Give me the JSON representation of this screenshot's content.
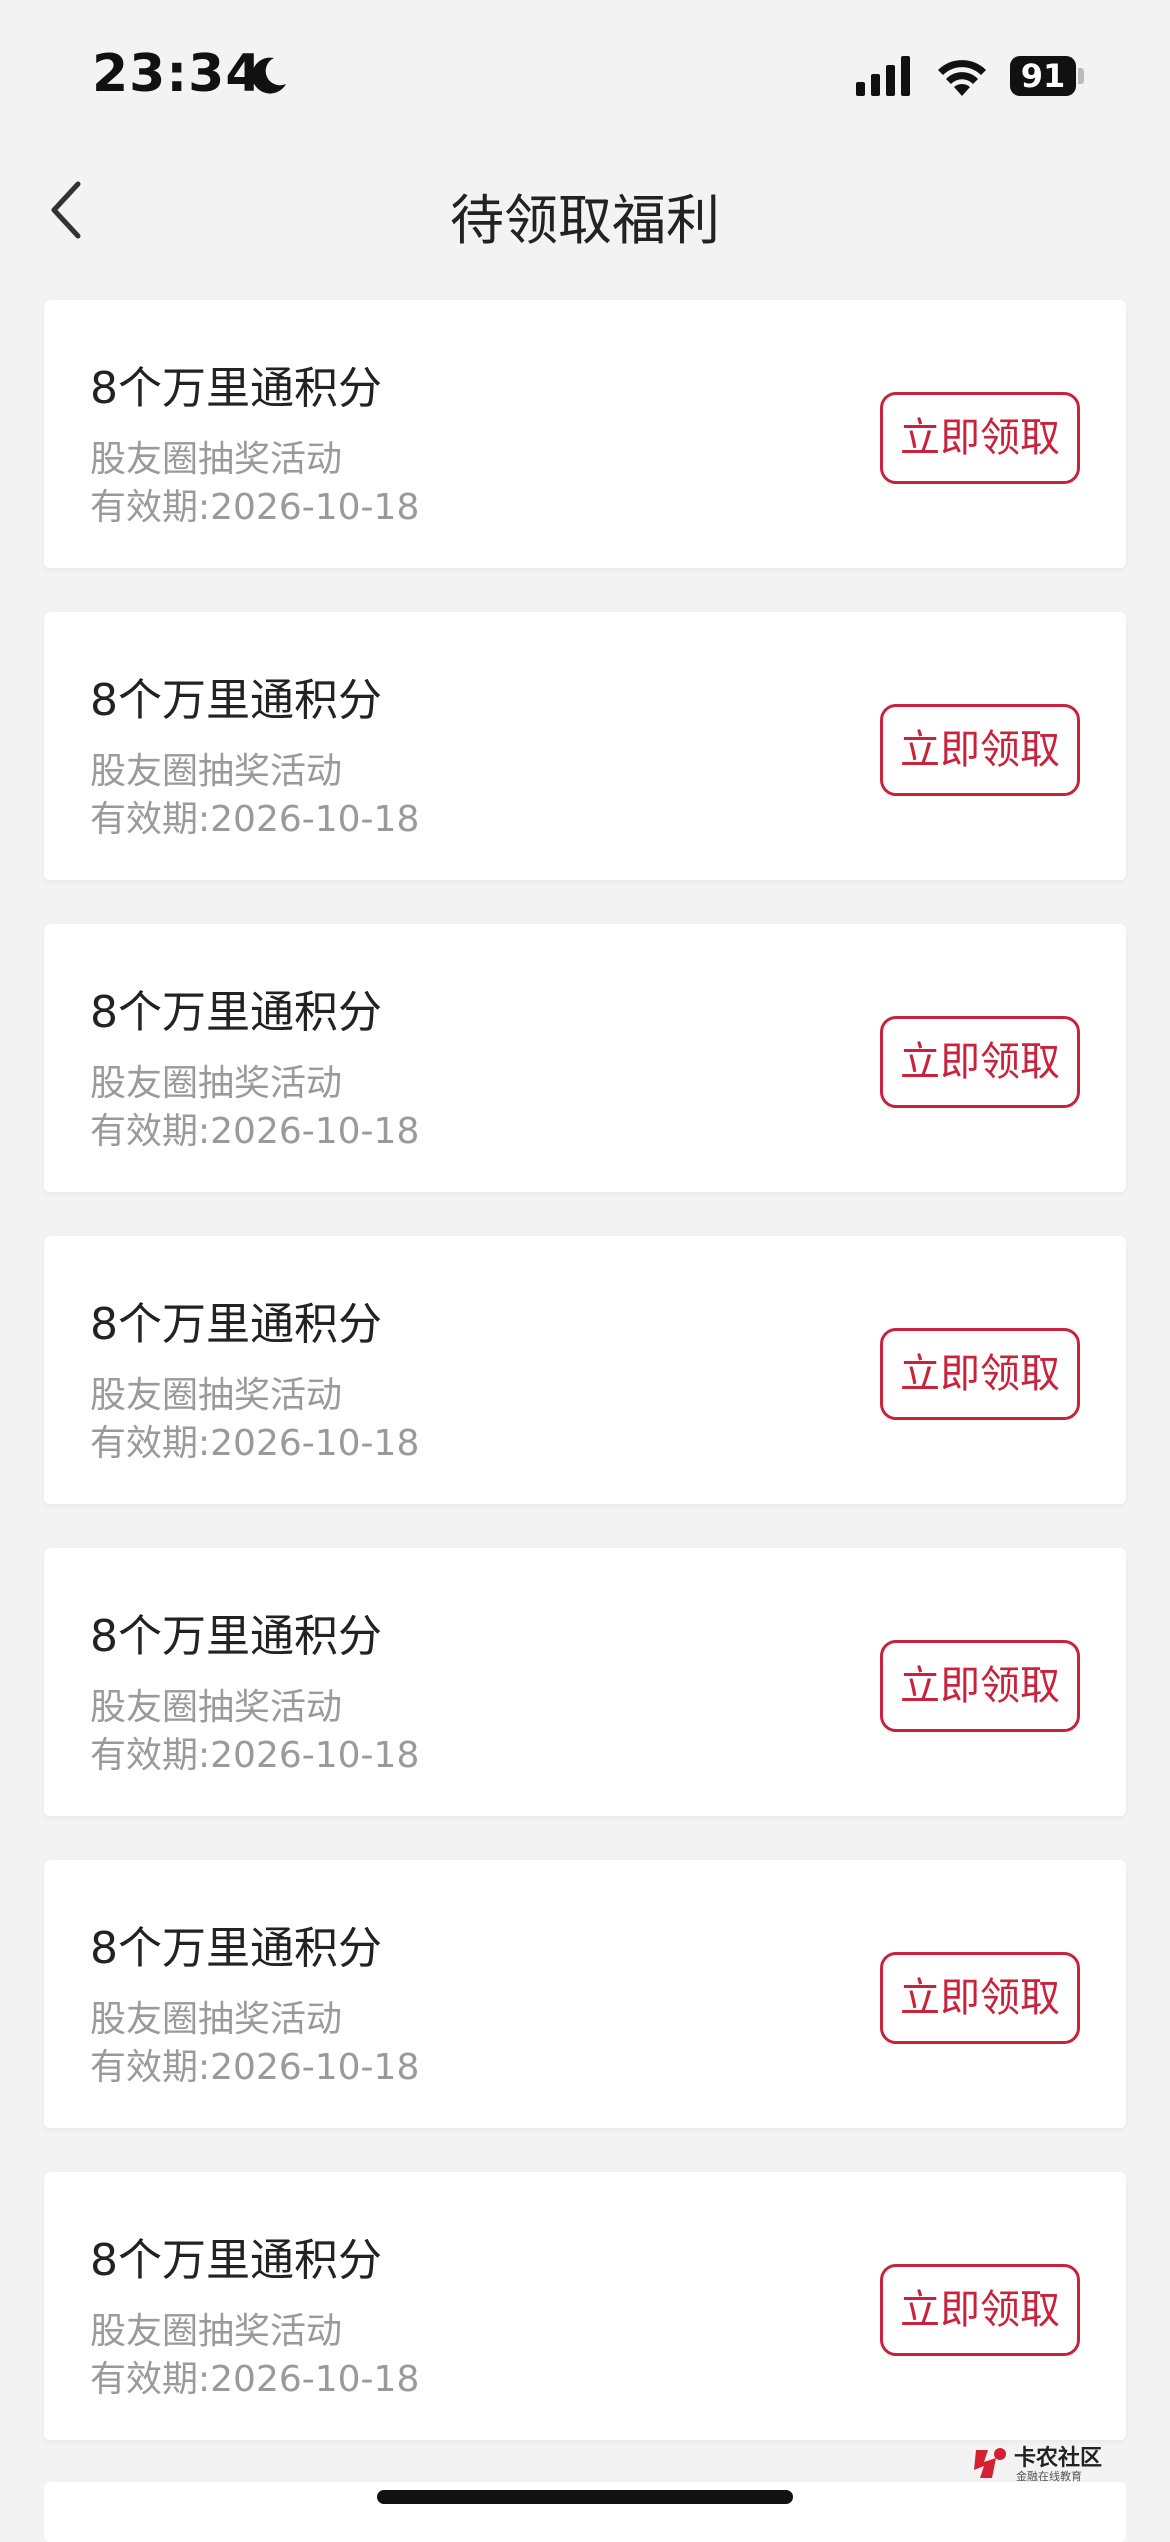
{
  "status_bar": {
    "time": "23:34",
    "battery": "91",
    "icons": [
      "moon-icon",
      "cellular-signal-icon",
      "wifi-icon",
      "battery-icon"
    ]
  },
  "nav": {
    "title": "待领取福利",
    "back_icon": "chevron-left-icon"
  },
  "rewards": [
    {
      "title": "8个万里通积分",
      "source": "股友圈抽奖活动",
      "expiry": "有效期:2026-10-18",
      "button": "立即领取"
    },
    {
      "title": "8个万里通积分",
      "source": "股友圈抽奖活动",
      "expiry": "有效期:2026-10-18",
      "button": "立即领取"
    },
    {
      "title": "8个万里通积分",
      "source": "股友圈抽奖活动",
      "expiry": "有效期:2026-10-18",
      "button": "立即领取"
    },
    {
      "title": "8个万里通积分",
      "source": "股友圈抽奖活动",
      "expiry": "有效期:2026-10-18",
      "button": "立即领取"
    },
    {
      "title": "8个万里通积分",
      "source": "股友圈抽奖活动",
      "expiry": "有效期:2026-10-18",
      "button": "立即领取"
    },
    {
      "title": "8个万里通积分",
      "source": "股友圈抽奖活动",
      "expiry": "有效期:2026-10-18",
      "button": "立即领取"
    },
    {
      "title": "8个万里通积分",
      "source": "股友圈抽奖活动",
      "expiry": "有效期:2026-10-18",
      "button": "立即领取"
    }
  ],
  "watermark": {
    "title": "卡农社区",
    "subtitle": "金融在线教育"
  },
  "colors": {
    "accent": "#c8233b",
    "background": "#f3f3f3",
    "card": "#ffffff",
    "secondary_text": "#9a9a9a"
  }
}
